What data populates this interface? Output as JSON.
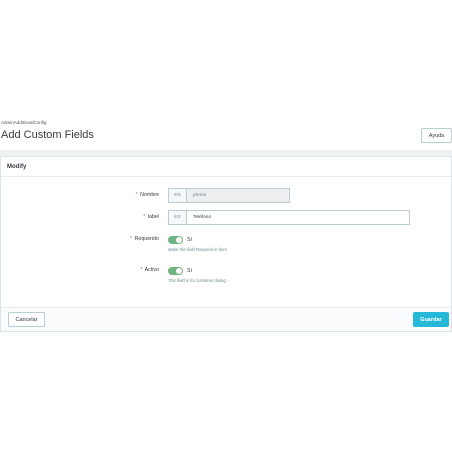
{
  "header": {
    "breadcrumb": "AdminAdditionalConfig",
    "title": "Add Custom Fields",
    "help_label": "Ayuda"
  },
  "panel": {
    "heading": "Modify",
    "fields": {
      "nombre": {
        "required_mark": "*",
        "label": "Nombre",
        "lang_addon": "ES",
        "value": "phone",
        "disabled": true
      },
      "label": {
        "required_mark": "*",
        "label": "label",
        "lang_addon": "ES",
        "value": "Teléfono",
        "disabled": false
      },
      "requerido": {
        "required_mark": "*",
        "label": "Requerido",
        "state": "Sí",
        "help": "Make this field Required in form"
      },
      "activo": {
        "required_mark": "*",
        "label": "Activo",
        "state": "Sí",
        "help": "This field is for customer dialog"
      }
    }
  },
  "footer": {
    "cancel_label": "Cancelar",
    "save_label": "Guardar"
  },
  "colors": {
    "accent": "#25b9d7",
    "switch_on": "#70b580",
    "required": "#c05c67"
  }
}
